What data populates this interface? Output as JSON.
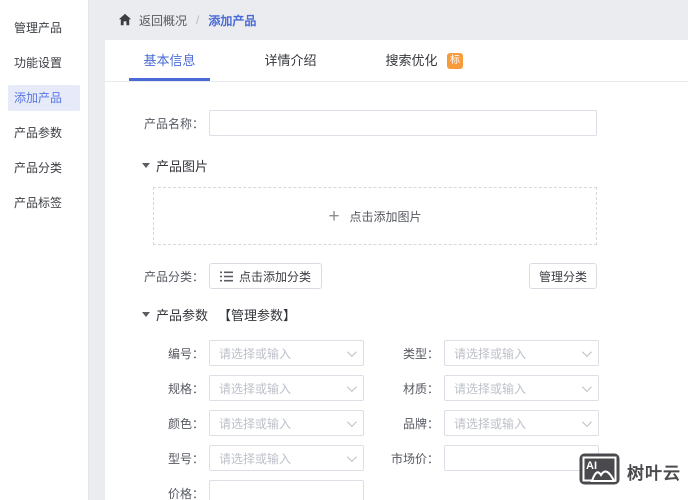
{
  "colors": {
    "accent": "#4a6bd6",
    "badge": "#f79b3c",
    "sidebar_active_bg": "#e7ebf9",
    "main_bg": "#ebecef"
  },
  "sidebar": {
    "items": [
      {
        "label": "管理产品",
        "active": false
      },
      {
        "label": "功能设置",
        "active": false
      },
      {
        "label": "添加产品",
        "active": true
      },
      {
        "label": "产品参数",
        "active": false
      },
      {
        "label": "产品分类",
        "active": false
      },
      {
        "label": "产品标签",
        "active": false
      }
    ]
  },
  "breadcrumb": {
    "back": "返回概况",
    "separator": "/",
    "current": "添加产品"
  },
  "tabs": {
    "items": [
      {
        "label": "基本信息",
        "active": true
      },
      {
        "label": "详情介绍",
        "active": false
      },
      {
        "label": "搜索优化",
        "active": false,
        "badge": "标"
      }
    ]
  },
  "form": {
    "name_label": "产品名称：",
    "name_value": "",
    "image_section": {
      "title": "产品图片",
      "plus": "+",
      "upload_hint": "点击添加图片"
    },
    "category": {
      "label": "产品分类：",
      "add_button": "点击添加分类",
      "manage_button": "管理分类"
    },
    "params_section": {
      "title": "产品参数",
      "manage_link": "【管理参数】"
    },
    "select_placeholder": "请选择或输入",
    "param_rows": [
      {
        "cells": [
          {
            "label": "编号：",
            "type": "select",
            "placeholder": "请选择或输入"
          },
          {
            "label": "类型：",
            "type": "select",
            "placeholder": "请选择或输入"
          }
        ]
      },
      {
        "cells": [
          {
            "label": "规格：",
            "type": "select",
            "placeholder": "请选择或输入"
          },
          {
            "label": "材质：",
            "type": "select",
            "placeholder": "请选择或输入"
          }
        ]
      },
      {
        "cells": [
          {
            "label": "颜色：",
            "type": "select",
            "placeholder": "请选择或输入"
          },
          {
            "label": "品牌：",
            "type": "select",
            "placeholder": "请选择或输入"
          }
        ]
      },
      {
        "cells": [
          {
            "label": "型号：",
            "type": "select",
            "placeholder": "请选择或输入"
          },
          {
            "label": "市场价：",
            "type": "input",
            "value": ""
          }
        ]
      },
      {
        "cells": [
          {
            "label": "价格：",
            "type": "input",
            "value": ""
          }
        ]
      }
    ]
  },
  "watermark": {
    "logo_text": "AI",
    "brand": "树叶云"
  }
}
